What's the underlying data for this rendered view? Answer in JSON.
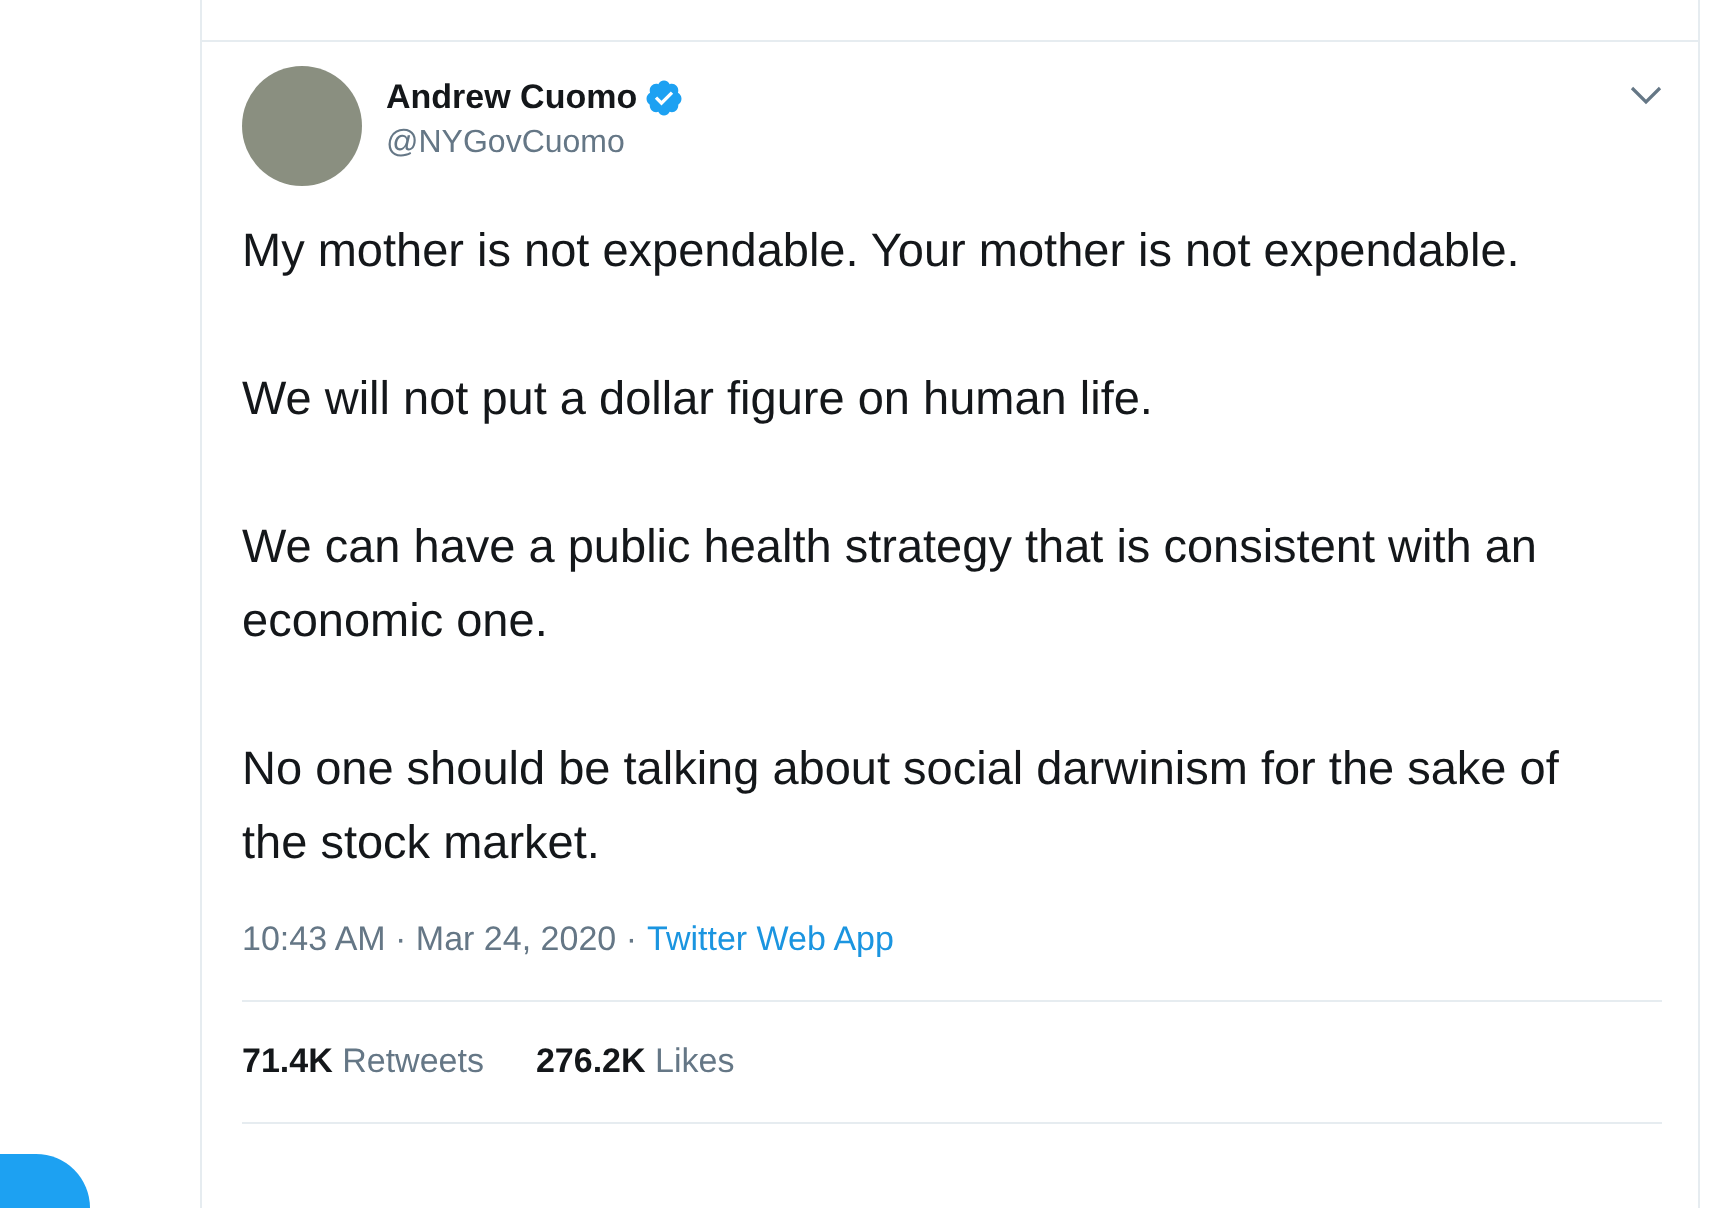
{
  "tweet": {
    "author": {
      "name": "Andrew Cuomo",
      "handle": "@NYGovCuomo",
      "verified": true
    },
    "paragraphs": [
      "My mother is not expendable. Your mother is not expendable.",
      "We will not put a dollar figure on human life.",
      "We can have a public health strategy that is consistent with an economic one.",
      "No one should be talking about social darwinism for the sake of the stock market."
    ],
    "timestamp": "10:43 AM · Mar 24, 2020 ·",
    "source": "Twitter Web App",
    "stats": [
      "**71.4K** Retweets",
      "**276.2K** Likes"
    ]
  }
}
